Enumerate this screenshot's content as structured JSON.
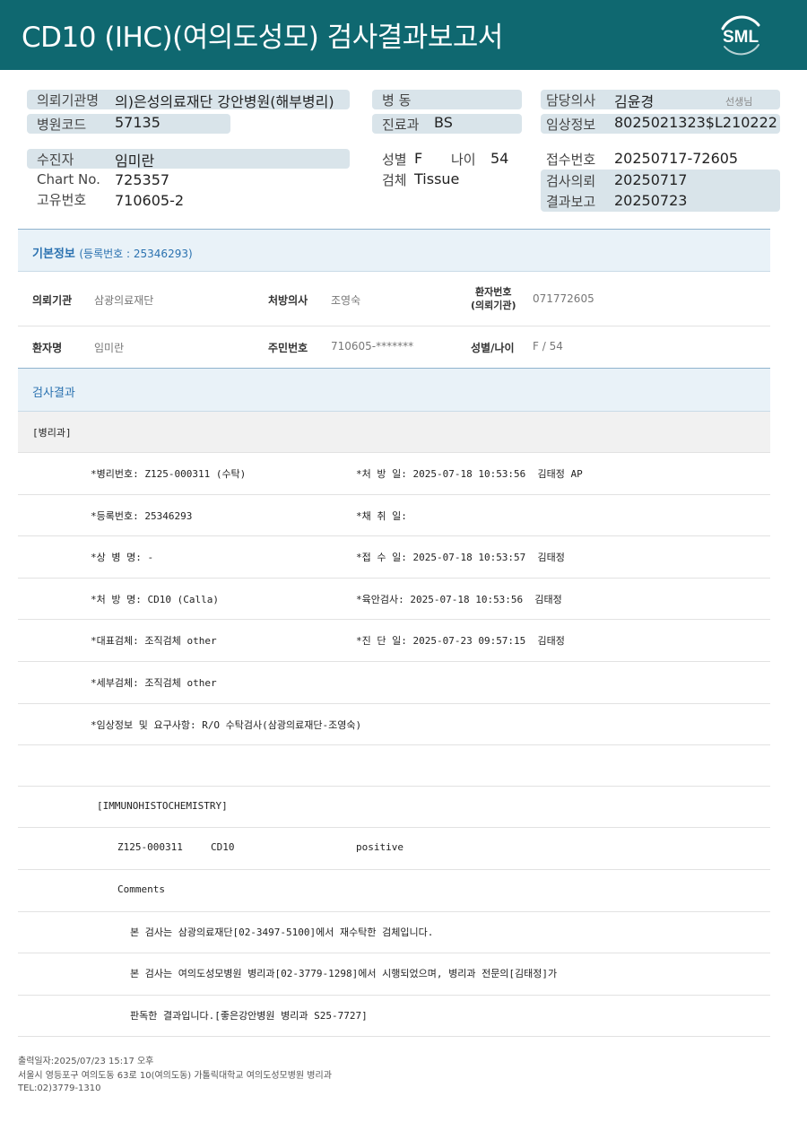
{
  "header": {
    "title": "CD10 (IHC)(여의도성모) 검사결과보고서",
    "logo_text": "SML",
    "bg_color": "#0f6870"
  },
  "patient_block": {
    "ref_inst_label": "의뢰기관명",
    "ref_inst_value": "의)은성의료재단 강안병원(해부병리)",
    "hosp_code_label": "병원코드",
    "hosp_code_value": "57135",
    "ward_label": "병 동",
    "dept_label": "진료과",
    "dept_value": "BS",
    "doctor_label": "담당의사",
    "doctor_value": "김윤경",
    "doctor_suffix": "선생님",
    "clinical_label": "임상정보",
    "clinical_value": "8025021323$L210222",
    "patient_label": "수진자",
    "patient_value": "임미란",
    "chart_label": "Chart No.",
    "chart_value": "725357",
    "unique_label": "고유번호",
    "unique_value": "710605-2",
    "sex_label": "성별",
    "sex_value": "F",
    "age_label": "나이",
    "age_value": "54",
    "specimen_label": "검체",
    "specimen_value": "Tissue",
    "receipt_label": "접수번호",
    "receipt_value": "20250717-72605",
    "request_label": "검사의뢰",
    "request_value": "20250717",
    "report_label": "결과보고",
    "report_value": "20250723"
  },
  "basic_info": {
    "title": "기본정보",
    "subtitle": "(등록번호 : 25346293)",
    "inst_label": "의뢰기관",
    "inst_value": "삼광의료재단",
    "presc_label": "처방의사",
    "presc_value": "조영숙",
    "patno_label_1": "환자번호",
    "patno_label_2": "(의뢰기관)",
    "patno_value": "071772605",
    "name_label": "환자명",
    "name_value": "임미란",
    "rrn_label": "주민번호",
    "rrn_value": "710605-*******",
    "sexage_label": "성별/나이",
    "sexage_value": "F / 54"
  },
  "results": {
    "title": "검사결과",
    "dept": "[병리과]",
    "lines": [
      {
        "left": "*병리번호: Z125-000311 (수탁)",
        "right": "*처 방 일: 2025-07-18 10:53:56  김태정 AP"
      },
      {
        "left": "*등록번호: 25346293",
        "right": "*채 취 일:"
      },
      {
        "left": "*상 병 명: -",
        "right": "*접 수 일: 2025-07-18 10:53:57  김태정"
      },
      {
        "left": "*처 방 명: CD10 (Calla)",
        "right": "*육안검사: 2025-07-18 10:53:56  김태정"
      },
      {
        "left": "*대표검체: 조직검체 other",
        "right": "*진 단 일: 2025-07-23 09:57:15  김태정"
      },
      {
        "left": "*세부검체: 조직검체 other",
        "right": ""
      },
      {
        "left": "*임상정보 및 요구사항: R/O 수탁검사(삼광의료재단-조영숙)",
        "right": ""
      }
    ],
    "ihc_header": "[IMMUNOHISTOCHEMISTRY]",
    "ihc_id": "Z125-000311",
    "ihc_marker": "CD10",
    "ihc_result": "positive",
    "comments_label": "Comments",
    "comment_1": "본 검사는 삼광의료재단[02-3497-5100]에서 재수탁한 검체입니다.",
    "comment_2": "본 검사는 여의도성모병원 병리과[02-3779-1298]에서 시행되었으며, 병리과 전문의[김태정]가",
    "comment_3": "판독한 결과입니다.[좋은강안병원 병리과 S25-7727]"
  },
  "footer": {
    "print_date": "출력일자:2025/07/23 15:17 오후",
    "address": "서울시 영등포구 여의도동 63로 10(여의도동) 가톨릭대학교 여의도성모병원 병리과",
    "tel": "TEL:02)3779-1310"
  }
}
